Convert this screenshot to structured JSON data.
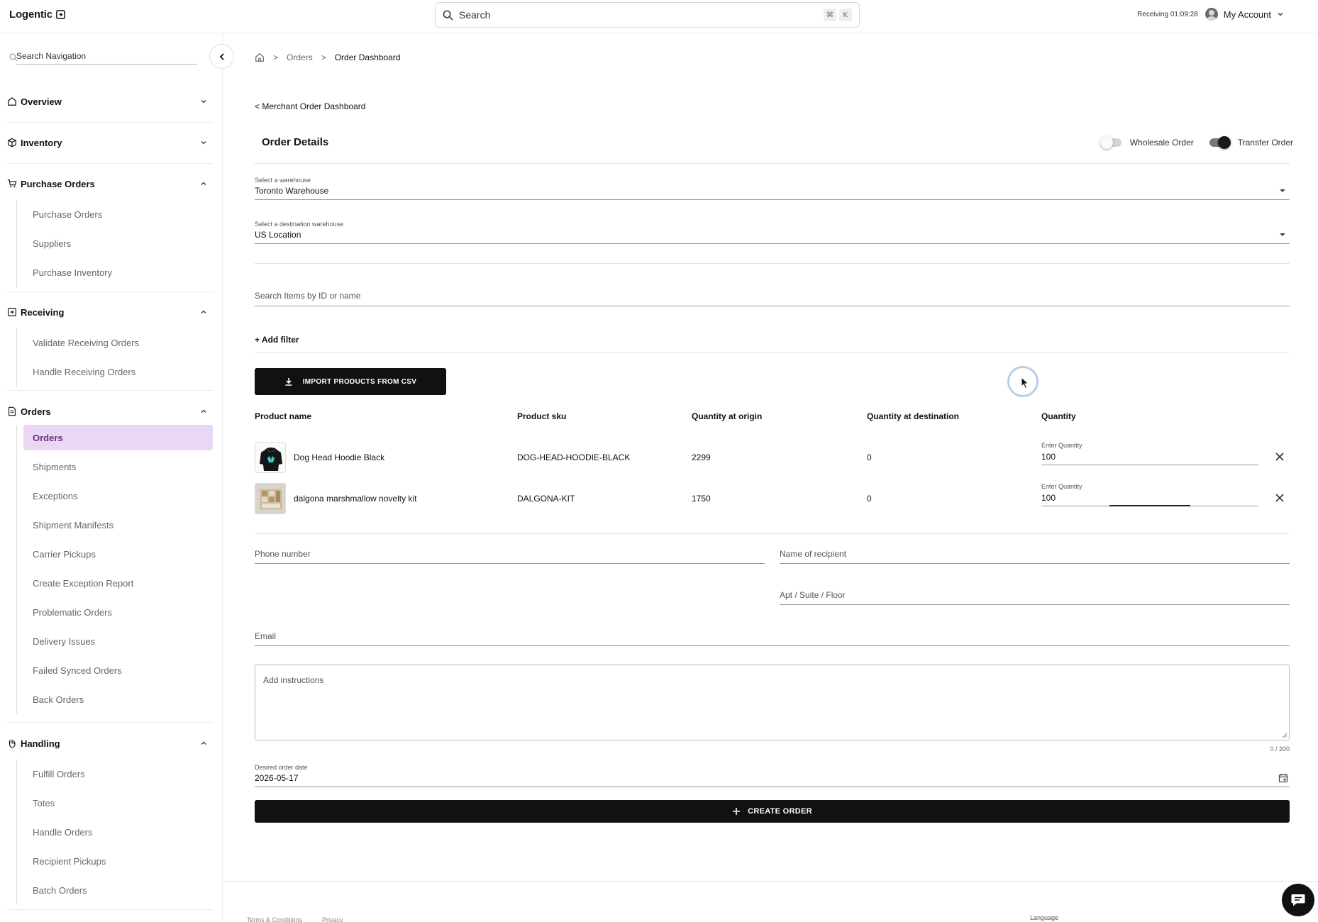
{
  "app": {
    "logo": "Logentic"
  },
  "topbar": {
    "search_placeholder": "Search",
    "shortcut_cmd": "⌘",
    "shortcut_key": "K",
    "receiving_label": "Receiving",
    "receiving_time": "01:09:28",
    "account_label": "My Account"
  },
  "sidebar": {
    "search_placeholder": "Search Navigation",
    "sections": {
      "overview": "Overview",
      "inventory": "Inventory",
      "purchase_orders": {
        "label": "Purchase Orders",
        "items": [
          "Purchase Orders",
          "Suppliers",
          "Purchase Inventory"
        ]
      },
      "receiving": {
        "label": "Receiving",
        "items": [
          "Validate Receiving Orders",
          "Handle Receiving Orders"
        ]
      },
      "orders": {
        "label": "Orders",
        "items": [
          "Orders",
          "Shipments",
          "Exceptions",
          "Shipment Manifests",
          "Carrier Pickups",
          "Create Exception Report",
          "Problematic Orders",
          "Delivery Issues",
          "Failed Synced Orders",
          "Back Orders"
        ]
      },
      "handling": {
        "label": "Handling",
        "items": [
          "Fulfill Orders",
          "Totes",
          "Handle Orders",
          "Recipient Pickups",
          "Batch Orders"
        ]
      }
    }
  },
  "breadcrumb": {
    "orders": "Orders",
    "current": "Order Dashboard"
  },
  "page": {
    "back_link": "< Merchant Order Dashboard",
    "title": "Order Details",
    "toggle_wholesale": "Wholesale Order",
    "toggle_transfer": "Transfer Order",
    "wholesale_on": false,
    "transfer_on": true
  },
  "form": {
    "warehouse_label": "Select a warehouse",
    "warehouse_value": "Toronto Warehouse",
    "destination_label": "Select a destination warehouse",
    "destination_value": "US Location",
    "search_items_placeholder": "Search Items by ID or name",
    "add_filter": "+ Add filter",
    "import_button": "IMPORT PRODUCTS FROM CSV",
    "phone_placeholder": "Phone number",
    "recipient_placeholder": "Name of recipient",
    "apt_placeholder": "Apt / Suite / Floor",
    "email_placeholder": "Email",
    "instructions_placeholder": "Add instructions",
    "instructions_counter": "0 / 200",
    "date_label": "Desired order date",
    "date_value": "2026-05-17",
    "create_button": "CREATE ORDER"
  },
  "table": {
    "headers": {
      "name": "Product name",
      "sku": "Product sku",
      "qty_origin": "Quantity at origin",
      "qty_destination": "Quantity at destination",
      "quantity": "Quantity"
    },
    "rows": [
      {
        "name": "Dog Head Hoodie Black",
        "sku": "DOG-HEAD-HOODIE-BLACK",
        "qty_origin": "2299",
        "qty_destination": "0",
        "qty_label": "Enter Quantity",
        "qty_value": "100"
      },
      {
        "name": "dalgona marshmallow novelty kit",
        "sku": "DALGONA-KIT",
        "qty_origin": "1750",
        "qty_destination": "0",
        "qty_label": "Enter Quantity",
        "qty_value": "100"
      }
    ]
  },
  "footer": {
    "terms": "Terms & Conditions",
    "privacy": "Privacy",
    "language": "Language"
  },
  "colors": {
    "active_nav_bg": "#ebd7f3",
    "active_nav_text": "#6b2c8c",
    "primary_button": "#111111"
  }
}
